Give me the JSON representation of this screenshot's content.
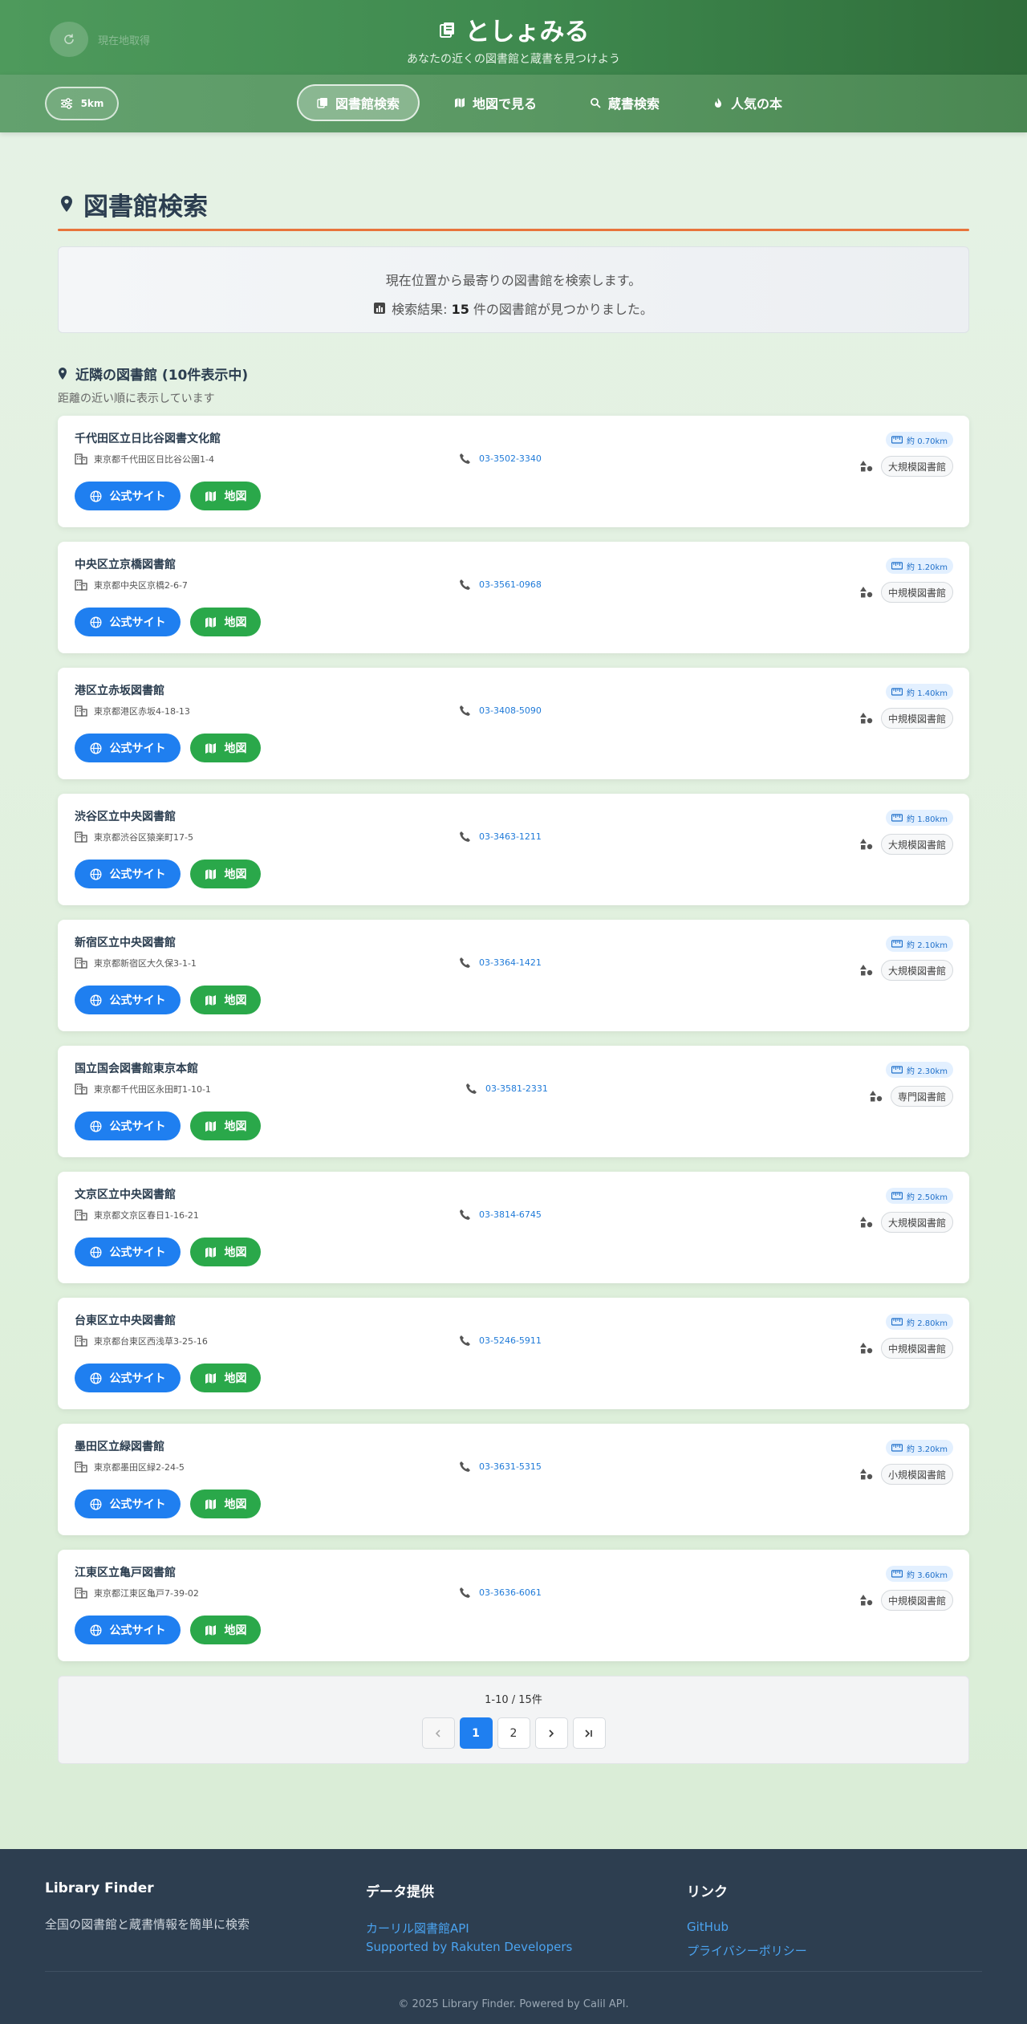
{
  "header": {
    "location_label": "現在地取得",
    "title": "としょみる",
    "subtitle": "あなたの近くの図書館と蔵書を見つけよう"
  },
  "nav": {
    "distance": "5km",
    "items": [
      {
        "label": "図書館検索",
        "icon": "library-icon",
        "active": true
      },
      {
        "label": "地図で見る",
        "icon": "map-icon",
        "active": false
      },
      {
        "label": "蔵書検索",
        "icon": "search-icon",
        "active": false
      },
      {
        "label": "人気の本",
        "icon": "fire-icon",
        "active": false
      }
    ]
  },
  "main": {
    "page_title": "図書館検索",
    "info_line1": "現在位置から最寄りの図書館を検索します。",
    "info_prefix": "検索結果: ",
    "info_count": "15",
    "info_suffix": " 件の図書館が見つかりました。",
    "section_title": "近隣の図書館 (10件表示中)",
    "section_sub": "距離の近い順に表示しています",
    "site_label": "公式サイト",
    "map_label": "地図"
  },
  "libraries": [
    {
      "name": "千代田区立日比谷図書文化館",
      "address": "東京都千代田区日比谷公園1-4",
      "phone": "03-3502-3340",
      "distance": "約 0.70km",
      "category": "大規模図書館"
    },
    {
      "name": "中央区立京橋図書館",
      "address": "東京都中央区京橋2-6-7",
      "phone": "03-3561-0968",
      "distance": "約 1.20km",
      "category": "中規模図書館"
    },
    {
      "name": "港区立赤坂図書館",
      "address": "東京都港区赤坂4-18-13",
      "phone": "03-3408-5090",
      "distance": "約 1.40km",
      "category": "中規模図書館"
    },
    {
      "name": "渋谷区立中央図書館",
      "address": "東京都渋谷区猿楽町17-5",
      "phone": "03-3463-1211",
      "distance": "約 1.80km",
      "category": "大規模図書館"
    },
    {
      "name": "新宿区立中央図書館",
      "address": "東京都新宿区大久保3-1-1",
      "phone": "03-3364-1421",
      "distance": "約 2.10km",
      "category": "大規模図書館"
    },
    {
      "name": "国立国会図書館東京本館",
      "address": "東京都千代田区永田町1-10-1",
      "phone": "03-3581-2331",
      "distance": "約 2.30km",
      "category": "専門図書館"
    },
    {
      "name": "文京区立中央図書館",
      "address": "東京都文京区春日1-16-21",
      "phone": "03-3814-6745",
      "distance": "約 2.50km",
      "category": "大規模図書館"
    },
    {
      "name": "台東区立中央図書館",
      "address": "東京都台東区西浅草3-25-16",
      "phone": "03-5246-5911",
      "distance": "約 2.80km",
      "category": "中規模図書館"
    },
    {
      "name": "墨田区立緑図書館",
      "address": "東京都墨田区緑2-24-5",
      "phone": "03-3631-5315",
      "distance": "約 3.20km",
      "category": "小規模図書館"
    },
    {
      "name": "江東区立亀戸図書館",
      "address": "東京都江東区亀戸7-39-02",
      "phone": "03-3636-6061",
      "distance": "約 3.60km",
      "category": "中規模図書館"
    }
  ],
  "pagination": {
    "range": "1-10 / 15件",
    "pages": [
      "1",
      "2"
    ],
    "current": "1"
  },
  "footer": {
    "col1_title": "Library Finder",
    "col1_text": "全国の図書館と蔵書情報を簡単に検索",
    "col2_title": "データ提供",
    "col2_links": [
      "カーリル図書館API",
      "Supported by Rakuten Developers"
    ],
    "col3_title": "リンク",
    "col3_links": [
      "GitHub",
      "プライバシーポリシー"
    ],
    "copyright": "© 2025 Library Finder. Powered by Calil API."
  }
}
